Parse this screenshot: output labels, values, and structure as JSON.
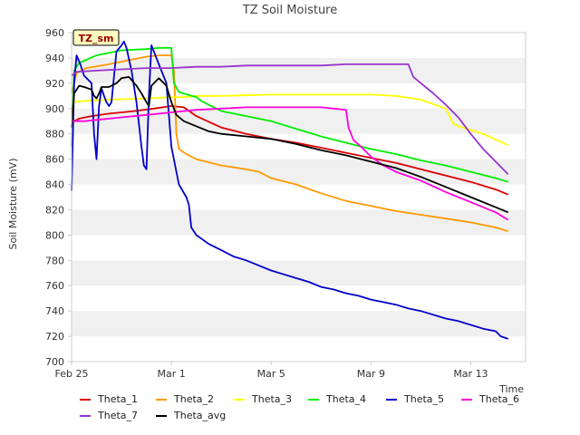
{
  "chart_data": {
    "type": "line",
    "title": "TZ Soil Moisture",
    "xlabel": "Time",
    "ylabel": "Soil Moisture (mV)",
    "annotation": "TZ_sm",
    "ylim": [
      700,
      960
    ],
    "yticks": [
      700,
      720,
      740,
      760,
      780,
      800,
      820,
      840,
      860,
      880,
      900,
      920,
      940,
      960
    ],
    "xlim": [
      "Feb 25",
      "Mar 16"
    ],
    "xtick_labels": [
      "Feb 25",
      "Mar 1",
      "Mar 5",
      "Mar 9",
      "Mar 13"
    ],
    "xtick_days": [
      0,
      4,
      8,
      12,
      16
    ],
    "grid": "alternating horizontal bands",
    "legend_position": "bottom",
    "series": [
      {
        "name": "Theta_1",
        "color": "#dd0000",
        "x": [
          0,
          0.3,
          0.8,
          1.5,
          2.5,
          3.3,
          4.0,
          4.5,
          5.0,
          6.0,
          7.0,
          8.0,
          9.0,
          10.0,
          11.0,
          12.0,
          13.0,
          14.0,
          15.0,
          16.0,
          17.0,
          17.5
        ],
        "y": [
          889,
          892,
          894,
          896,
          898,
          900,
          902,
          901,
          894,
          885,
          880,
          876,
          873,
          869,
          865,
          861,
          857,
          852,
          847,
          842,
          836,
          832
        ]
      },
      {
        "name": "Theta_2",
        "color": "#ff9900",
        "x": [
          0,
          0.2,
          0.6,
          1.5,
          2.5,
          3.0,
          3.5,
          4.0,
          4.1,
          4.2,
          4.3,
          4.6,
          5.0,
          6.0,
          7.0,
          7.5,
          8.0,
          9.0,
          10.0,
          11.0,
          12.0,
          13.0,
          14.0,
          15.0,
          16.0,
          17.0,
          17.5
        ],
        "y": [
          912,
          928,
          932,
          935,
          939,
          941,
          942,
          942,
          930,
          880,
          868,
          864,
          860,
          855,
          852,
          850,
          845,
          840,
          833,
          827,
          823,
          819,
          816,
          813,
          810,
          806,
          803
        ]
      },
      {
        "name": "Theta_3",
        "color": "#ffff00",
        "x": [
          0,
          0.5,
          1.5,
          3.0,
          4.0,
          4.5,
          5.0,
          6.0,
          8.0,
          10.0,
          12.0,
          13.0,
          14.0,
          15.0,
          15.3,
          15.5,
          16.5,
          17.5
        ],
        "y": [
          905,
          906,
          907,
          908,
          909,
          909,
          910,
          910,
          911,
          911,
          911,
          910,
          907,
          900,
          888,
          886,
          880,
          871
        ]
      },
      {
        "name": "Theta_4",
        "color": "#00ee00",
        "x": [
          0,
          0.1,
          0.3,
          1.0,
          1.5,
          2.0,
          3.0,
          3.5,
          4.0,
          4.1,
          4.3,
          5.0,
          5.2,
          6.0,
          7.0,
          8.0,
          9.0,
          10.0,
          11.0,
          12.0,
          13.0,
          14.0,
          15.0,
          16.0,
          17.0,
          17.5
        ],
        "y": [
          870,
          930,
          936,
          942,
          944,
          946,
          947,
          948,
          948,
          920,
          913,
          909,
          906,
          898,
          894,
          890,
          884,
          878,
          873,
          868,
          864,
          859,
          855,
          850,
          845,
          842
        ]
      },
      {
        "name": "Theta_5",
        "color": "#0000cc",
        "x": [
          0,
          0.1,
          0.2,
          0.35,
          0.5,
          0.8,
          0.9,
          1.0,
          1.1,
          1.2,
          1.3,
          1.4,
          1.5,
          1.6,
          1.8,
          2.0,
          2.1,
          2.2,
          2.4,
          2.6,
          2.8,
          2.9,
          3.0,
          3.1,
          3.2,
          3.3,
          3.5,
          3.8,
          4.0,
          4.3,
          4.6,
          4.7,
          4.8,
          5.0,
          5.5,
          6.0,
          6.5,
          7.0,
          7.5,
          8.0,
          8.5,
          9.0,
          9.5,
          10.0,
          10.5,
          11.0,
          11.5,
          12.0,
          12.5,
          13.0,
          13.5,
          14.0,
          14.5,
          15.0,
          15.5,
          16.0,
          16.5,
          17.0,
          17.2,
          17.5
        ],
        "y": [
          835,
          920,
          942,
          935,
          926,
          920,
          880,
          860,
          902,
          916,
          910,
          905,
          902,
          905,
          945,
          950,
          953,
          948,
          930,
          905,
          870,
          855,
          852,
          910,
          950,
          945,
          935,
          920,
          870,
          840,
          830,
          824,
          806,
          800,
          793,
          788,
          783,
          780,
          776,
          772,
          769,
          766,
          763,
          759,
          757,
          754,
          752,
          749,
          747,
          745,
          742,
          740,
          737,
          734,
          732,
          729,
          726,
          724,
          720,
          718
        ]
      },
      {
        "name": "Theta_6",
        "color": "#ff00dd",
        "x": [
          0,
          0.5,
          1.0,
          2.0,
          3.0,
          4.0,
          5.0,
          6.0,
          7.0,
          8.0,
          9.0,
          10.0,
          10.5,
          11.0,
          11.1,
          11.3,
          11.6,
          12.0,
          12.5,
          13.0,
          14.0,
          15.0,
          16.0,
          17.0,
          17.5
        ],
        "y": [
          890,
          890,
          891,
          893,
          895,
          897,
          899,
          900,
          901,
          901,
          901,
          901,
          900,
          899,
          885,
          875,
          870,
          862,
          855,
          850,
          843,
          834,
          826,
          818,
          812
        ]
      },
      {
        "name": "Theta_7",
        "color": "#9933cc",
        "x": [
          0,
          0.2,
          1.0,
          2.0,
          3.0,
          4.0,
          5.0,
          6.0,
          7.0,
          8.0,
          9.0,
          10.0,
          11.0,
          12.0,
          13.0,
          13.5,
          13.7,
          14.0,
          14.5,
          15.0,
          15.5,
          16.0,
          16.5,
          17.0,
          17.5
        ],
        "y": [
          926,
          929,
          930,
          931,
          932,
          932,
          933,
          933,
          934,
          934,
          934,
          934,
          935,
          935,
          935,
          935,
          925,
          920,
          912,
          903,
          893,
          880,
          868,
          858,
          848
        ]
      },
      {
        "name": "Theta_avg",
        "color": "#000000",
        "x": [
          0,
          0.1,
          0.3,
          0.5,
          0.8,
          0.9,
          1.0,
          1.1,
          1.2,
          1.5,
          1.8,
          2.0,
          2.3,
          2.6,
          2.8,
          3.0,
          3.1,
          3.2,
          3.5,
          3.8,
          4.0,
          4.2,
          4.5,
          5.0,
          5.5,
          6.0,
          7.0,
          8.0,
          9.0,
          10.0,
          11.0,
          12.0,
          13.0,
          14.0,
          15.0,
          16.0,
          17.0,
          17.5
        ],
        "y": [
          885,
          912,
          918,
          917,
          915,
          910,
          908,
          912,
          917,
          917,
          920,
          924,
          925,
          918,
          912,
          905,
          902,
          918,
          924,
          918,
          905,
          895,
          890,
          886,
          882,
          880,
          878,
          876,
          872,
          867,
          863,
          858,
          853,
          846,
          838,
          830,
          822,
          818
        ]
      }
    ]
  }
}
